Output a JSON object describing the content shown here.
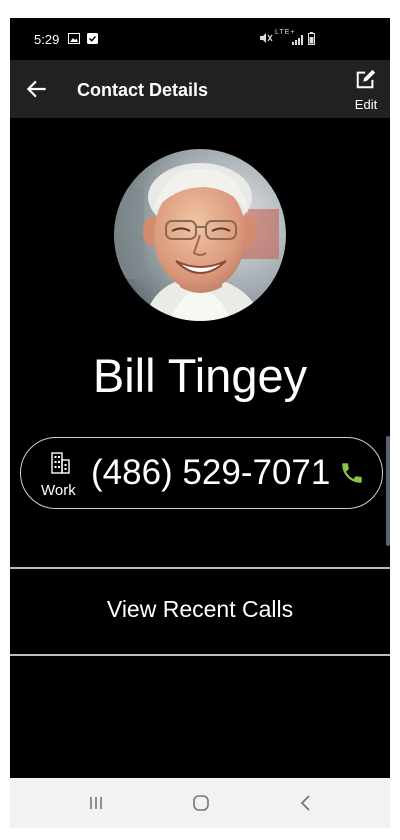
{
  "status_bar": {
    "time": "5:29",
    "right_indicators": "LTE+"
  },
  "app_bar": {
    "title": "Contact Details",
    "edit_label": "Edit"
  },
  "contact": {
    "name": "Bill Tingey",
    "phone_type": "Work",
    "phone_number": "(486) 529-7071"
  },
  "actions": {
    "recent_calls_label": "View Recent Calls"
  },
  "colors": {
    "background": "#000000",
    "app_bar": "#212121",
    "call_icon": "#8BC34A",
    "nav_bar": "#f2f2f2"
  },
  "icons": [
    "back-arrow-icon",
    "edit-icon",
    "building-icon",
    "phone-call-icon",
    "recents-icon",
    "home-icon",
    "back-nav-icon"
  ]
}
